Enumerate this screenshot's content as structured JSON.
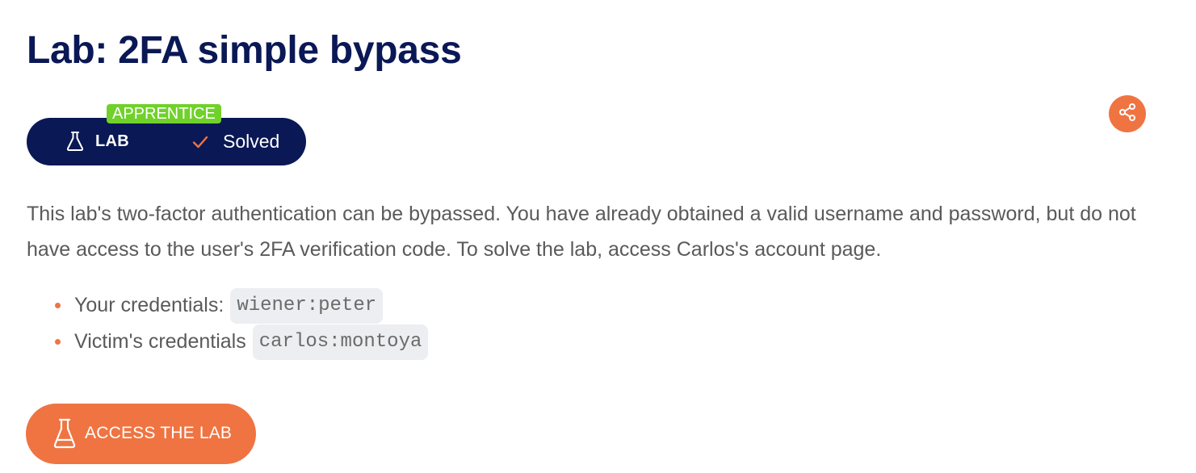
{
  "title": "Lab: 2FA simple bypass",
  "badge": {
    "level": "APPRENTICE",
    "type_label": "LAB",
    "status": "Solved",
    "type_icon": "flask-icon",
    "status_icon": "check-icon"
  },
  "share": {
    "icon": "share-icon"
  },
  "description": "This lab's two-factor authentication can be bypassed. You have already obtained a valid username and password, but do not have access to the user's 2FA verification code. To solve the lab, access Carlos's account page.",
  "credentials": [
    {
      "label": "Your credentials:",
      "value": "wiener:peter"
    },
    {
      "label": "Victim's credentials",
      "value": "carlos:montoya"
    }
  ],
  "access_button": {
    "label": "ACCESS THE LAB",
    "icon": "flask-icon"
  },
  "colors": {
    "navy": "#0a1855",
    "accent": "#ef7442",
    "level_green": "#70d12b",
    "text": "#5a5a5a",
    "code_bg": "#eceef1"
  }
}
